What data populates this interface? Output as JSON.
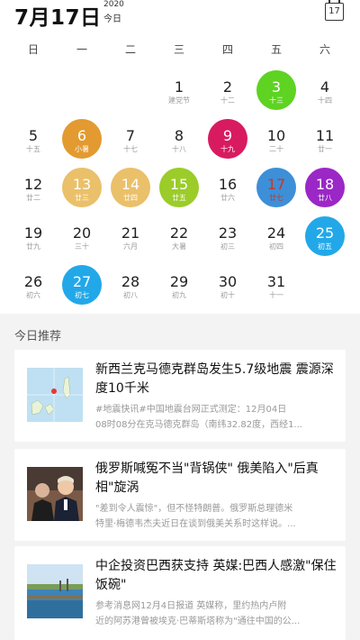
{
  "header": {
    "date": "7月17日",
    "year": "2020",
    "today": "今日",
    "calendar_icon_day": "17"
  },
  "weekdays": [
    "日",
    "一",
    "二",
    "三",
    "四",
    "五",
    "六"
  ],
  "days": [
    {
      "n": "1",
      "l": "建党节"
    },
    {
      "n": "2",
      "l": "十二"
    },
    {
      "n": "3",
      "l": "十三"
    },
    {
      "n": "4",
      "l": "十四"
    },
    {
      "n": "5",
      "l": "十五"
    },
    {
      "n": "6",
      "l": "小暑"
    },
    {
      "n": "7",
      "l": "十七"
    },
    {
      "n": "8",
      "l": "十八"
    },
    {
      "n": "9",
      "l": "十九"
    },
    {
      "n": "10",
      "l": "二十"
    },
    {
      "n": "11",
      "l": "廿一"
    },
    {
      "n": "12",
      "l": "廿二"
    },
    {
      "n": "13",
      "l": "廿三"
    },
    {
      "n": "14",
      "l": "廿四"
    },
    {
      "n": "15",
      "l": "廿五"
    },
    {
      "n": "16",
      "l": "廿六"
    },
    {
      "n": "17",
      "l": "廿七"
    },
    {
      "n": "18",
      "l": "廿八"
    },
    {
      "n": "19",
      "l": "廿九"
    },
    {
      "n": "20",
      "l": "三十"
    },
    {
      "n": "21",
      "l": "六月"
    },
    {
      "n": "22",
      "l": "大暑"
    },
    {
      "n": "23",
      "l": "初三"
    },
    {
      "n": "24",
      "l": "初四"
    },
    {
      "n": "25",
      "l": "初五"
    },
    {
      "n": "26",
      "l": "初六"
    },
    {
      "n": "27",
      "l": "初七"
    },
    {
      "n": "28",
      "l": "初八"
    },
    {
      "n": "29",
      "l": "初九"
    },
    {
      "n": "30",
      "l": "初十"
    },
    {
      "n": "31",
      "l": "十一"
    }
  ],
  "highlights": {
    "3": "#5ed321",
    "6": "#e39a30",
    "9": "#d81b60",
    "13": "#eac06a",
    "14": "#eac06a",
    "15": "#9bcc2a",
    "17": "#3d8fd8",
    "18": "#9b27c6",
    "25": "#22a8e8",
    "27": "#22a8e8"
  },
  "today_day": "17",
  "section_title": "今日推荐",
  "news": [
    {
      "title": "新西兰克马德克群岛发生5.7级地震 震源深度10千米",
      "desc1": "#地震快讯#中国地震台网正式测定：12月04日",
      "desc2": "08时08分在克马德克群岛（南纬32.82度，西经1..."
    },
    {
      "title": "俄罗斯喊冤不当\"背锅侠\" 俄美陷入\"后真相\"旋涡",
      "desc1": "\"差到令人震惊\"，但不怪特朗普。俄罗斯总理德米",
      "desc2": "特里·梅德韦杰夫近日在谈到俄美关系时这样说。..."
    },
    {
      "title": "中企投资巴西获支持 英媒:巴西人感激\"保住饭碗\"",
      "desc1": "参考消息网12月4日报道 英媒称，里约热内卢附",
      "desc2": "近的阿苏港曾被埃克·巴蒂斯塔称为\"通往中国的公..."
    }
  ]
}
